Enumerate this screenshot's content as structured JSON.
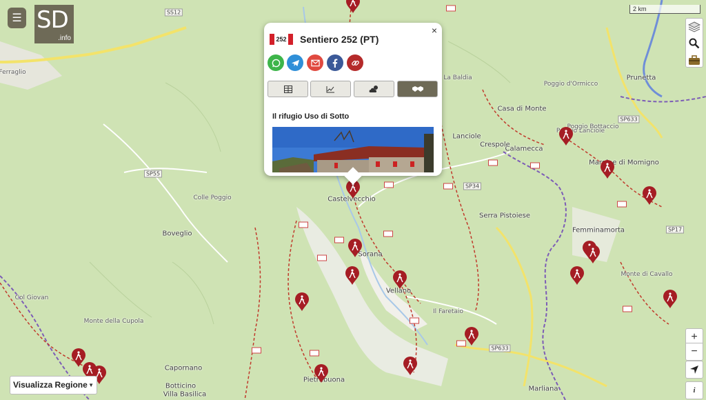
{
  "menu": {
    "icon": "hamburger-icon"
  },
  "logo": {
    "big": "SD",
    "small": ".info"
  },
  "scale": {
    "label": "2 km"
  },
  "popup": {
    "trail_number": "252",
    "title": "Sentiero 252 (PT)",
    "share_buttons": [
      {
        "name": "whatsapp-icon",
        "color": "#3db54a"
      },
      {
        "name": "telegram-icon",
        "color": "#2f8fd8"
      },
      {
        "name": "email-icon",
        "color": "#e0493f"
      },
      {
        "name": "facebook-icon",
        "color": "#3b5998"
      },
      {
        "name": "link-icon",
        "color": "#b52a2a"
      }
    ],
    "tabs": [
      {
        "name": "table-icon",
        "active": false
      },
      {
        "name": "elevation-chart-icon",
        "active": false
      },
      {
        "name": "weather-icon",
        "active": false
      },
      {
        "name": "handshake-icon",
        "active": true
      }
    ],
    "refuge_label": "Il rifugio Uso di Sotto"
  },
  "region_select": {
    "label": "Visualizza Regione"
  },
  "controls": {
    "zoom_in": "+",
    "zoom_out": "−",
    "locate": "locate-icon",
    "info": "i"
  },
  "colors": {
    "accent": "#6e6a57",
    "pin": "#a51d24",
    "trail": "#c0392b",
    "boundary": "#7c5cb6",
    "highway": "#f3e36a"
  },
  "places": [
    {
      "id": "ferraglio",
      "text": "Ferraglio"
    },
    {
      "id": "castelvecchio",
      "text": "Castelvecchio"
    },
    {
      "id": "sorana",
      "text": "Sorana"
    },
    {
      "id": "vellano",
      "text": "Vellano"
    },
    {
      "id": "boveglio",
      "text": "Boveglio"
    },
    {
      "id": "calamecca",
      "text": "Calamecca"
    },
    {
      "id": "crespole",
      "text": "Crespole"
    },
    {
      "id": "lanciole",
      "text": "Lanciole"
    },
    {
      "id": "casa-di-monte",
      "text": "Casa di Monte"
    },
    {
      "id": "serra-pistoiese",
      "text": "Serra Pistoiese"
    },
    {
      "id": "pruneta",
      "text": "Prunetta"
    },
    {
      "id": "femminamorta",
      "text": "Femminamorta"
    },
    {
      "id": "margine",
      "text": "Margine di Momigno"
    },
    {
      "id": "marliana",
      "text": "Marliana"
    },
    {
      "id": "pietrabuona",
      "text": "Pietrabuona"
    },
    {
      "id": "botticino",
      "text": "Botticino"
    },
    {
      "id": "villa-basilica",
      "text": "Villa Basilica"
    },
    {
      "id": "capornano",
      "text": "Capornano"
    },
    {
      "id": "colle-giovan",
      "text": "Col Giovan"
    },
    {
      "id": "monte-cupola",
      "text": "Monte della Cupola"
    },
    {
      "id": "colle-poggio",
      "text": "Colle Poggio"
    },
    {
      "id": "il-faretaio",
      "text": "Il Faretaio"
    },
    {
      "id": "poggio-lanciole",
      "text": "Poggio Lanciole"
    },
    {
      "id": "poggio-bottaccio",
      "text": "Poggio Bottaccio"
    },
    {
      "id": "monte-cavallo",
      "text": "Monte di Cavallo"
    },
    {
      "id": "poggio-ormicco",
      "text": "Poggio d'Ormicco"
    },
    {
      "id": "poggiolo-balza",
      "text": "La Baldia"
    }
  ],
  "roads": [
    {
      "id": "ss12",
      "text": "SS12"
    },
    {
      "id": "sp55",
      "text": "SP55"
    },
    {
      "id": "sp34",
      "text": "SP34"
    },
    {
      "id": "sp633",
      "text": "SP633"
    },
    {
      "id": "sp633b",
      "text": "SP633"
    },
    {
      "id": "sp17",
      "text": "SP17"
    }
  ]
}
